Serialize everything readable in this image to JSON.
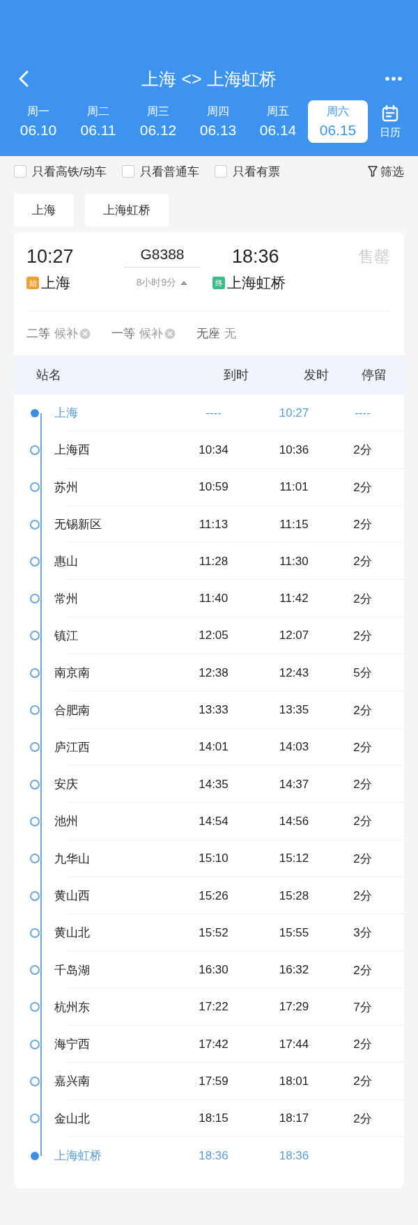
{
  "header": {
    "title": "上海 <> 上海虹桥"
  },
  "dates": [
    {
      "weekday": "周一",
      "date": "06.10",
      "selected": false
    },
    {
      "weekday": "周二",
      "date": "06.11",
      "selected": false
    },
    {
      "weekday": "周三",
      "date": "06.12",
      "selected": false
    },
    {
      "weekday": "周四",
      "date": "06.13",
      "selected": false
    },
    {
      "weekday": "周五",
      "date": "06.14",
      "selected": false
    },
    {
      "weekday": "周六",
      "date": "06.15",
      "selected": true
    }
  ],
  "calendar_label": "日历",
  "filters": [
    {
      "label": "只看高铁/动车",
      "checked": false
    },
    {
      "label": "只看普通车",
      "checked": false
    },
    {
      "label": "只看有票",
      "checked": false
    }
  ],
  "filter_button": "筛选",
  "station_tabs": [
    "上海",
    "上海虹桥"
  ],
  "train": {
    "depart_time": "10:27",
    "number": "G8388",
    "arrive_time": "18:36",
    "status": "售罄",
    "from_badge": "始",
    "from": "上海",
    "duration": "8小时9分",
    "to_badge": "终",
    "to": "上海虹桥",
    "seats": [
      {
        "class": "二等",
        "availability": "候补",
        "waitlist": true
      },
      {
        "class": "一等",
        "availability": "候补",
        "waitlist": true
      },
      {
        "class": "无座",
        "availability": "无",
        "waitlist": false
      }
    ]
  },
  "table": {
    "columns": [
      "站名",
      "到时",
      "发时",
      "停留"
    ],
    "rows": [
      {
        "kind": "terminal",
        "station": "上海",
        "arrive": "----",
        "depart": "10:27",
        "stay": "----"
      },
      {
        "kind": "stop",
        "station": "上海西",
        "arrive": "10:34",
        "depart": "10:36",
        "stay": "2分"
      },
      {
        "kind": "stop",
        "station": "苏州",
        "arrive": "10:59",
        "depart": "11:01",
        "stay": "2分"
      },
      {
        "kind": "stop",
        "station": "无锡新区",
        "arrive": "11:13",
        "depart": "11:15",
        "stay": "2分"
      },
      {
        "kind": "stop",
        "station": "惠山",
        "arrive": "11:28",
        "depart": "11:30",
        "stay": "2分"
      },
      {
        "kind": "stop",
        "station": "常州",
        "arrive": "11:40",
        "depart": "11:42",
        "stay": "2分"
      },
      {
        "kind": "stop",
        "station": "镇江",
        "arrive": "12:05",
        "depart": "12:07",
        "stay": "2分"
      },
      {
        "kind": "stop",
        "station": "南京南",
        "arrive": "12:38",
        "depart": "12:43",
        "stay": "5分"
      },
      {
        "kind": "stop",
        "station": "合肥南",
        "arrive": "13:33",
        "depart": "13:35",
        "stay": "2分"
      },
      {
        "kind": "stop",
        "station": "庐江西",
        "arrive": "14:01",
        "depart": "14:03",
        "stay": "2分"
      },
      {
        "kind": "stop",
        "station": "安庆",
        "arrive": "14:35",
        "depart": "14:37",
        "stay": "2分"
      },
      {
        "kind": "stop",
        "station": "池州",
        "arrive": "14:54",
        "depart": "14:56",
        "stay": "2分"
      },
      {
        "kind": "stop",
        "station": "九华山",
        "arrive": "15:10",
        "depart": "15:12",
        "stay": "2分"
      },
      {
        "kind": "stop",
        "station": "黄山西",
        "arrive": "15:26",
        "depart": "15:28",
        "stay": "2分"
      },
      {
        "kind": "stop",
        "station": "黄山北",
        "arrive": "15:52",
        "depart": "15:55",
        "stay": "3分"
      },
      {
        "kind": "stop",
        "station": "千岛湖",
        "arrive": "16:30",
        "depart": "16:32",
        "stay": "2分"
      },
      {
        "kind": "stop",
        "station": "杭州东",
        "arrive": "17:22",
        "depart": "17:29",
        "stay": "7分"
      },
      {
        "kind": "stop",
        "station": "海宁西",
        "arrive": "17:42",
        "depart": "17:44",
        "stay": "2分"
      },
      {
        "kind": "stop",
        "station": "嘉兴南",
        "arrive": "17:59",
        "depart": "18:01",
        "stay": "2分"
      },
      {
        "kind": "stop",
        "station": "金山北",
        "arrive": "18:15",
        "depart": "18:17",
        "stay": "2分"
      },
      {
        "kind": "terminal",
        "station": "上海虹桥",
        "arrive": "18:36",
        "depart": "18:36"
      }
    ]
  }
}
